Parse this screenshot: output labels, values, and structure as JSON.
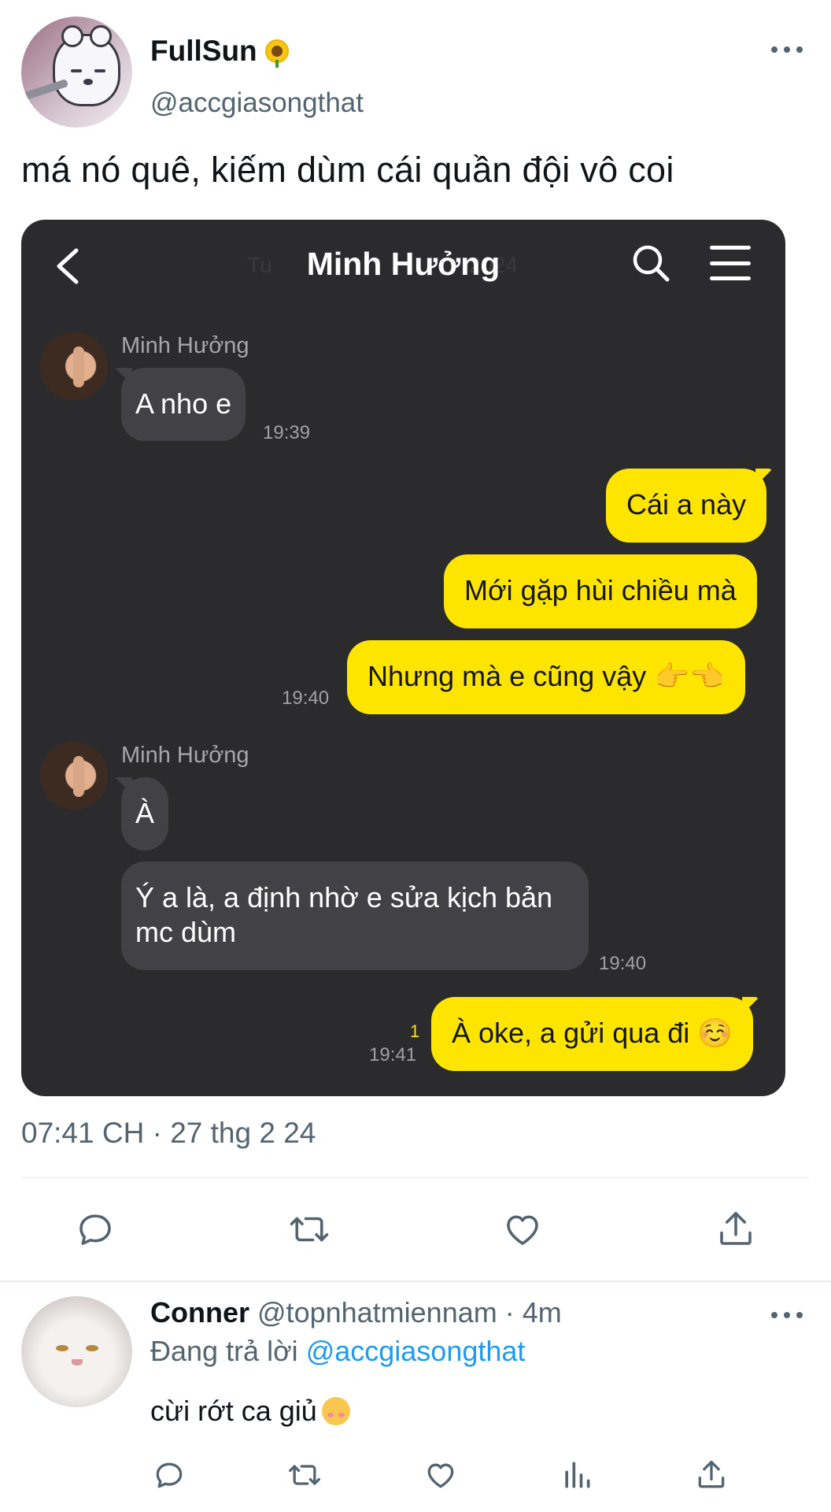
{
  "tweet": {
    "display_name": "FullSun",
    "name_emoji": "sunflower",
    "handle": "@accgiasongthat",
    "text": "má nó quê, kiếm dùm cái quần đội vô coi",
    "timestamp": "07:41 CH · 27 thg 2 24",
    "actions": [
      "reply-icon",
      "retweet-icon",
      "like-icon",
      "share-icon"
    ]
  },
  "chat": {
    "title": "Minh Hưởng",
    "date_ghost_left": "Tu",
    "date_ghost_right": "2024",
    "messages": [
      {
        "sender": "Minh Hưởng",
        "direction": "in",
        "text": "A nho e",
        "time": "19:39"
      },
      {
        "direction": "out",
        "text": "Cái a này"
      },
      {
        "direction": "out",
        "text": "Mới gặp hùi chiều mà"
      },
      {
        "direction": "out",
        "text": "Nhưng mà e cũng vậy 👉👈",
        "time": "19:40"
      },
      {
        "sender": "Minh Hưởng",
        "direction": "in",
        "text": "À"
      },
      {
        "direction": "in",
        "text_line1": "Ý a là, a định nhờ e sửa kịch bản",
        "text_line2": "mc dùm",
        "time": "19:40"
      },
      {
        "direction": "out",
        "text": "À oke, a gửi qua đi ☺️",
        "time": "19:41",
        "unread": "1"
      }
    ]
  },
  "reply": {
    "display_name": "Conner",
    "handle_time": "@topnhatmiennam · 4m",
    "replying_label": "Đang trả lời",
    "replying_to": "@accgiasongthat",
    "text": "cừi rớt ca giủ",
    "text_emoji": "smiling-face-with-hearts",
    "actions": [
      "reply-icon",
      "retweet-icon",
      "like-icon",
      "views-icon",
      "share-icon"
    ]
  },
  "colors": {
    "kakao_yellow": "#fee500",
    "chat_bg": "#2b2b2d",
    "incoming_bubble": "#424246",
    "twitter_blue": "#1d9bf0",
    "secondary_text": "#536471"
  }
}
